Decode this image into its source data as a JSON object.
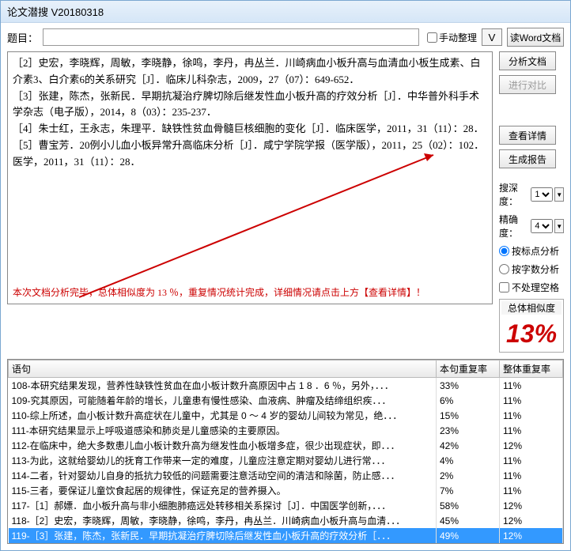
{
  "window_title": "论文潜搜 V20180318",
  "top": {
    "topic_label": "题目：",
    "topic_value": "",
    "manual_label": "手动整理",
    "v_label": "V"
  },
  "side_buttons": {
    "read_word": "读Word文档",
    "analyze": "分析文档",
    "compare": "进行对比",
    "detail": "查看详情",
    "report": "生成报告"
  },
  "params": {
    "depth_label": "搜深度：",
    "depth_value": "1",
    "precision_label": "精确度：",
    "precision_value": "4",
    "by_punct": "按标点分析",
    "by_chars": "按字数分析",
    "no_space": "不处理空格"
  },
  "similarity": {
    "label": "总体相似度",
    "value": "13%"
  },
  "refs": [
    "［2］史宏，李晓辉，周敏，李晓静，徐鸣，李丹，冉丛兰．川崎病血小板升高与血清血小板生成素、白介素3、白介素6的关系研究［J］．临床儿科杂志，2009，27（07）：649-652．",
    "［3］张建，陈杰，张新民．早期抗凝治疗脾切除后继发性血小板升高的疗效分析［J］．中华普外科手术学杂志（电子版），2014，8（03）：235-237．",
    "［4］朱士红，王永志，朱理平．缺铁性贫血骨髓巨核细胞的变化［J］．临床医学，2011，31（11）：28．",
    "［5］曹宝芳．20例小儿血小板异常升高临床分析［J］．咸宁学院学报（医学版），2011，25（02）：102．医学，2011，31（11）：28．"
  ],
  "summary_line": "本次文档分析完毕，总体相似度为 13 ％，重复情况统计完成，详细情况请点击上方【查看详情】！",
  "table": {
    "headers": {
      "sentence": "语句",
      "sent_rate": "本句重复率",
      "total_rate": "整体重复率"
    },
    "rows": [
      {
        "s": "108-本研究结果发现，营养性缺铁性贫血在血小板计数升高原因中占 1 8 ．6 ％，另外，．．．",
        "a": "33%",
        "b": "11%"
      },
      {
        "s": "109-究其原因，可能随着年龄的增长，儿童患有慢性感染、血液病、肿瘤及结缔组织疾．．．",
        "a": "6%",
        "b": "11%"
      },
      {
        "s": "110-综上所述，血小板计数升高症状在儿童中，尤其是 0 ～ 4 岁的婴幼儿间较为常见，绝．．．",
        "a": "15%",
        "b": "11%"
      },
      {
        "s": "111-本研究结果显示上呼吸道感染和肺炎是儿童感染的主要原因。",
        "a": "23%",
        "b": "11%"
      },
      {
        "s": "112-在临床中，绝大多数患儿血小板计数升高为继发性血小板增多症，很少出现症状，即．．．",
        "a": "42%",
        "b": "12%"
      },
      {
        "s": "113-为此，这就给婴幼儿的抚育工作带来一定的难度，儿童应注意定期对婴幼儿进行常．．．",
        "a": "4%",
        "b": "11%"
      },
      {
        "s": "114-二者，针对婴幼儿自身的抵抗力较低的问题需要注意活动空间的清洁和除菌，防止感．．．",
        "a": "2%",
        "b": "11%"
      },
      {
        "s": "115-三者，要保证儿童饮食起居的规律性，保证充足的营养摄入。",
        "a": "7%",
        "b": "11%"
      },
      {
        "s": "117-［1］郝嫖．血小板升高与非小细胞肺癌远处转移相关系探讨［J］．中国医学创新，．．．",
        "a": "58%",
        "b": "12%"
      },
      {
        "s": "118-［2］史宏，李晓辉，周敏，李晓静，徐鸣，李丹，冉丛兰．川崎病血小板升高与血清．．．",
        "a": "45%",
        "b": "12%"
      },
      {
        "s": "119-［3］张建，陈杰，张新民．早期抗凝治疗脾切除后继发性血小板升高的疗效分析［．．．",
        "a": "49%",
        "b": "12%",
        "sel": true
      }
    ]
  }
}
